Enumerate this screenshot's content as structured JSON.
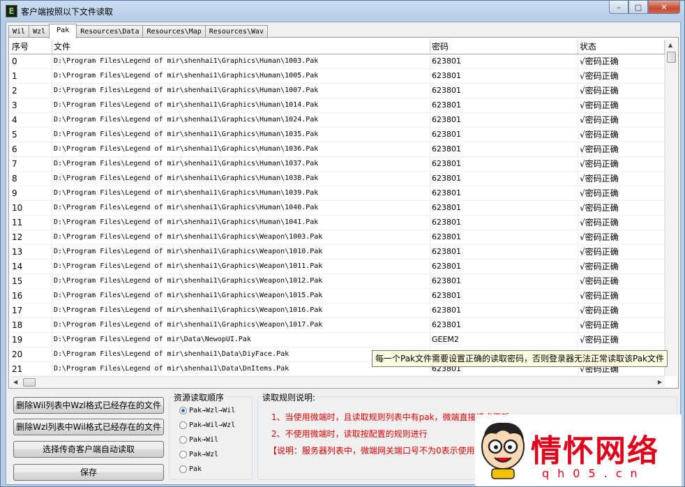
{
  "window": {
    "title": "客户端按照以下文件读取",
    "icon_letter": "E"
  },
  "tabs": [
    {
      "label": "Wil",
      "active": false
    },
    {
      "label": "Wzl",
      "active": false
    },
    {
      "label": "Pak",
      "active": true
    },
    {
      "label": "Resources\\Data",
      "active": false
    },
    {
      "label": "Resources\\Map",
      "active": false
    },
    {
      "label": "Resources\\Wav",
      "active": false
    }
  ],
  "table": {
    "headers": [
      "序号",
      "文件",
      "密码",
      "状态"
    ],
    "rows": [
      [
        "0",
        "D:\\Program Files\\Legend of mir\\shenhai1\\Graphics\\Human\\1003.Pak",
        "623801",
        "√密码正确"
      ],
      [
        "1",
        "D:\\Program Files\\Legend of mir\\shenhai1\\Graphics\\Human\\1005.Pak",
        "623801",
        "√密码正确"
      ],
      [
        "2",
        "D:\\Program Files\\Legend of mir\\shenhai1\\Graphics\\Human\\1007.Pak",
        "623801",
        "√密码正确"
      ],
      [
        "3",
        "D:\\Program Files\\Legend of mir\\shenhai1\\Graphics\\Human\\1014.Pak",
        "623801",
        "√密码正确"
      ],
      [
        "4",
        "D:\\Program Files\\Legend of mir\\shenhai1\\Graphics\\Human\\1024.Pak",
        "623801",
        "√密码正确"
      ],
      [
        "5",
        "D:\\Program Files\\Legend of mir\\shenhai1\\Graphics\\Human\\1035.Pak",
        "623801",
        "√密码正确"
      ],
      [
        "6",
        "D:\\Program Files\\Legend of mir\\shenhai1\\Graphics\\Human\\1036.Pak",
        "623801",
        "√密码正确"
      ],
      [
        "7",
        "D:\\Program Files\\Legend of mir\\shenhai1\\Graphics\\Human\\1037.Pak",
        "623801",
        "√密码正确"
      ],
      [
        "8",
        "D:\\Program Files\\Legend of mir\\shenhai1\\Graphics\\Human\\1038.Pak",
        "623801",
        "√密码正确"
      ],
      [
        "9",
        "D:\\Program Files\\Legend of mir\\shenhai1\\Graphics\\Human\\1039.Pak",
        "623801",
        "√密码正确"
      ],
      [
        "10",
        "D:\\Program Files\\Legend of mir\\shenhai1\\Graphics\\Human\\1040.Pak",
        "623801",
        "√密码正确"
      ],
      [
        "11",
        "D:\\Program Files\\Legend of mir\\shenhai1\\Graphics\\Human\\1041.Pak",
        "623801",
        "√密码正确"
      ],
      [
        "12",
        "D:\\Program Files\\Legend of mir\\shenhai1\\Graphics\\Weapon\\1003.Pak",
        "623801",
        "√密码正确"
      ],
      [
        "13",
        "D:\\Program Files\\Legend of mir\\shenhai1\\Graphics\\Weapon\\1010.Pak",
        "623801",
        "√密码正确"
      ],
      [
        "14",
        "D:\\Program Files\\Legend of mir\\shenhai1\\Graphics\\Weapon\\1011.Pak",
        "623801",
        "√密码正确"
      ],
      [
        "15",
        "D:\\Program Files\\Legend of mir\\shenhai1\\Graphics\\Weapon\\1012.Pak",
        "623801",
        "√密码正确"
      ],
      [
        "16",
        "D:\\Program Files\\Legend of mir\\shenhai1\\Graphics\\Weapon\\1015.Pak",
        "623801",
        "√密码正确"
      ],
      [
        "17",
        "D:\\Program Files\\Legend of mir\\shenhai1\\Graphics\\Weapon\\1016.Pak",
        "623801",
        "√密码正确"
      ],
      [
        "18",
        "D:\\Program Files\\Legend of mir\\shenhai1\\Graphics\\Weapon\\1017.Pak",
        "623801",
        "√密码正确"
      ],
      [
        "19",
        "D:\\Program Files\\Legend of mir\\Data\\NewopUI.Pak",
        "GEEM2",
        "√密码正确"
      ],
      [
        "20",
        "D:\\Program Files\\Legend of mir\\shenhai1\\Data\\DiyFace.Pak",
        "",
        "√密码正确"
      ],
      [
        "21",
        "D:\\Program Files\\Legend of mir\\shenhai1\\Data\\DnItems.Pak",
        "623801",
        "√密码正确"
      ]
    ]
  },
  "tooltip": "每一个Pak文件需要设置正确的读取密码，否则登录器无法正常读取该Pak文件",
  "buttons": {
    "delete_wil": "删除Wil列表中Wzl格式已经存在的文件",
    "delete_wzl": "删除Wzl列表中Wil格式已经存在的文件",
    "select_client": "选择传奇客户端自动读取",
    "save": "保存"
  },
  "order_group": {
    "title": "资源读取顺序",
    "options": [
      {
        "label": "Pak→Wzl→Wil",
        "selected": true
      },
      {
        "label": "Pak→Wil→Wzl",
        "selected": false
      },
      {
        "label": "Pak→Wil",
        "selected": false
      },
      {
        "label": "Pak→Wzl",
        "selected": false
      },
      {
        "label": "Pak",
        "selected": false
      }
    ]
  },
  "rules_group": {
    "title": "读取规则说明:",
    "lines": [
      "1、当使用微端时，且读取规则列表中有pak，微端直接请求更新",
      "2、不使用微端时，读取按配置的规则进行",
      "【说明：服务器列表中，微端网关端口号不为0表示使用微"
    ]
  },
  "watermark": {
    "brand": "情怀网络",
    "url": "qh05.cn"
  },
  "colors": {
    "rule_text": "#e00000",
    "brand": "#e0001a",
    "tooltip_bg": "#ffffe1"
  }
}
